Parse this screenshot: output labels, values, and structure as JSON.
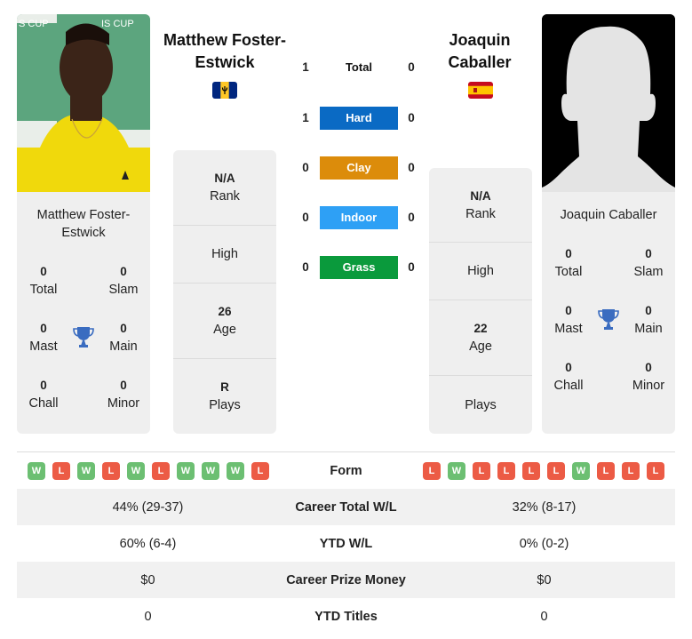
{
  "colors": {
    "hard": "#0a6ac4",
    "clay": "#dc8c0b",
    "indoor": "#2ea0f5",
    "grass": "#0a9a3c",
    "win": "#6cbf72",
    "loss": "#ec5b45",
    "trophy": "#3a6cc0"
  },
  "player1": {
    "name": "Matthew Foster-Estwick",
    "name_line1": "Matthew Foster-",
    "name_line2": "Estwick",
    "flag": "barbados-flag",
    "card_name_line1": "Matthew Foster-",
    "card_name_line2": "Estwick",
    "titles": {
      "total": {
        "value": "0",
        "label": "Total"
      },
      "slam": {
        "value": "0",
        "label": "Slam"
      },
      "mast": {
        "value": "0",
        "label": "Mast"
      },
      "main": {
        "value": "0",
        "label": "Main"
      },
      "chall": {
        "value": "0",
        "label": "Chall"
      },
      "minor": {
        "value": "0",
        "label": "Minor"
      }
    },
    "info": {
      "rank": {
        "value": "N/A",
        "label": "Rank"
      },
      "high": {
        "value": "",
        "label": "High"
      },
      "age": {
        "value": "26",
        "label": "Age"
      },
      "plays": {
        "value": "R",
        "label": "Plays"
      }
    },
    "form": [
      "W",
      "L",
      "W",
      "L",
      "W",
      "L",
      "W",
      "W",
      "W",
      "L"
    ]
  },
  "player2": {
    "name": "Joaquin Caballer",
    "name_line1": "Joaquin",
    "name_line2": "Caballer",
    "flag": "spain-flag",
    "card_name_line1": "Joaquin Caballer",
    "titles": {
      "total": {
        "value": "0",
        "label": "Total"
      },
      "slam": {
        "value": "0",
        "label": "Slam"
      },
      "mast": {
        "value": "0",
        "label": "Mast"
      },
      "main": {
        "value": "0",
        "label": "Main"
      },
      "chall": {
        "value": "0",
        "label": "Chall"
      },
      "minor": {
        "value": "0",
        "label": "Minor"
      }
    },
    "info": {
      "rank": {
        "value": "N/A",
        "label": "Rank"
      },
      "high": {
        "value": "",
        "label": "High"
      },
      "age": {
        "value": "22",
        "label": "Age"
      },
      "plays": {
        "value": "",
        "label": "Plays"
      }
    },
    "form": [
      "L",
      "W",
      "L",
      "L",
      "L",
      "L",
      "W",
      "L",
      "L",
      "L"
    ]
  },
  "h2h": {
    "total": {
      "label": "Total",
      "p1": "1",
      "p2": "0"
    },
    "surfaces": [
      {
        "key": "hard",
        "label": "Hard",
        "p1": "1",
        "p2": "0"
      },
      {
        "key": "clay",
        "label": "Clay",
        "p1": "0",
        "p2": "0"
      },
      {
        "key": "indoor",
        "label": "Indoor",
        "p1": "0",
        "p2": "0"
      },
      {
        "key": "grass",
        "label": "Grass",
        "p1": "0",
        "p2": "0"
      }
    ]
  },
  "table": {
    "form_label": "Form",
    "rows": [
      {
        "label": "Career Total W/L",
        "p1": "44% (29-37)",
        "p2": "32% (8-17)"
      },
      {
        "label": "YTD W/L",
        "p1": "60% (6-4)",
        "p2": "0% (0-2)"
      },
      {
        "label": "Career Prize Money",
        "p1": "$0",
        "p2": "$0"
      },
      {
        "label": "YTD Titles",
        "p1": "0",
        "p2": "0"
      }
    ]
  }
}
